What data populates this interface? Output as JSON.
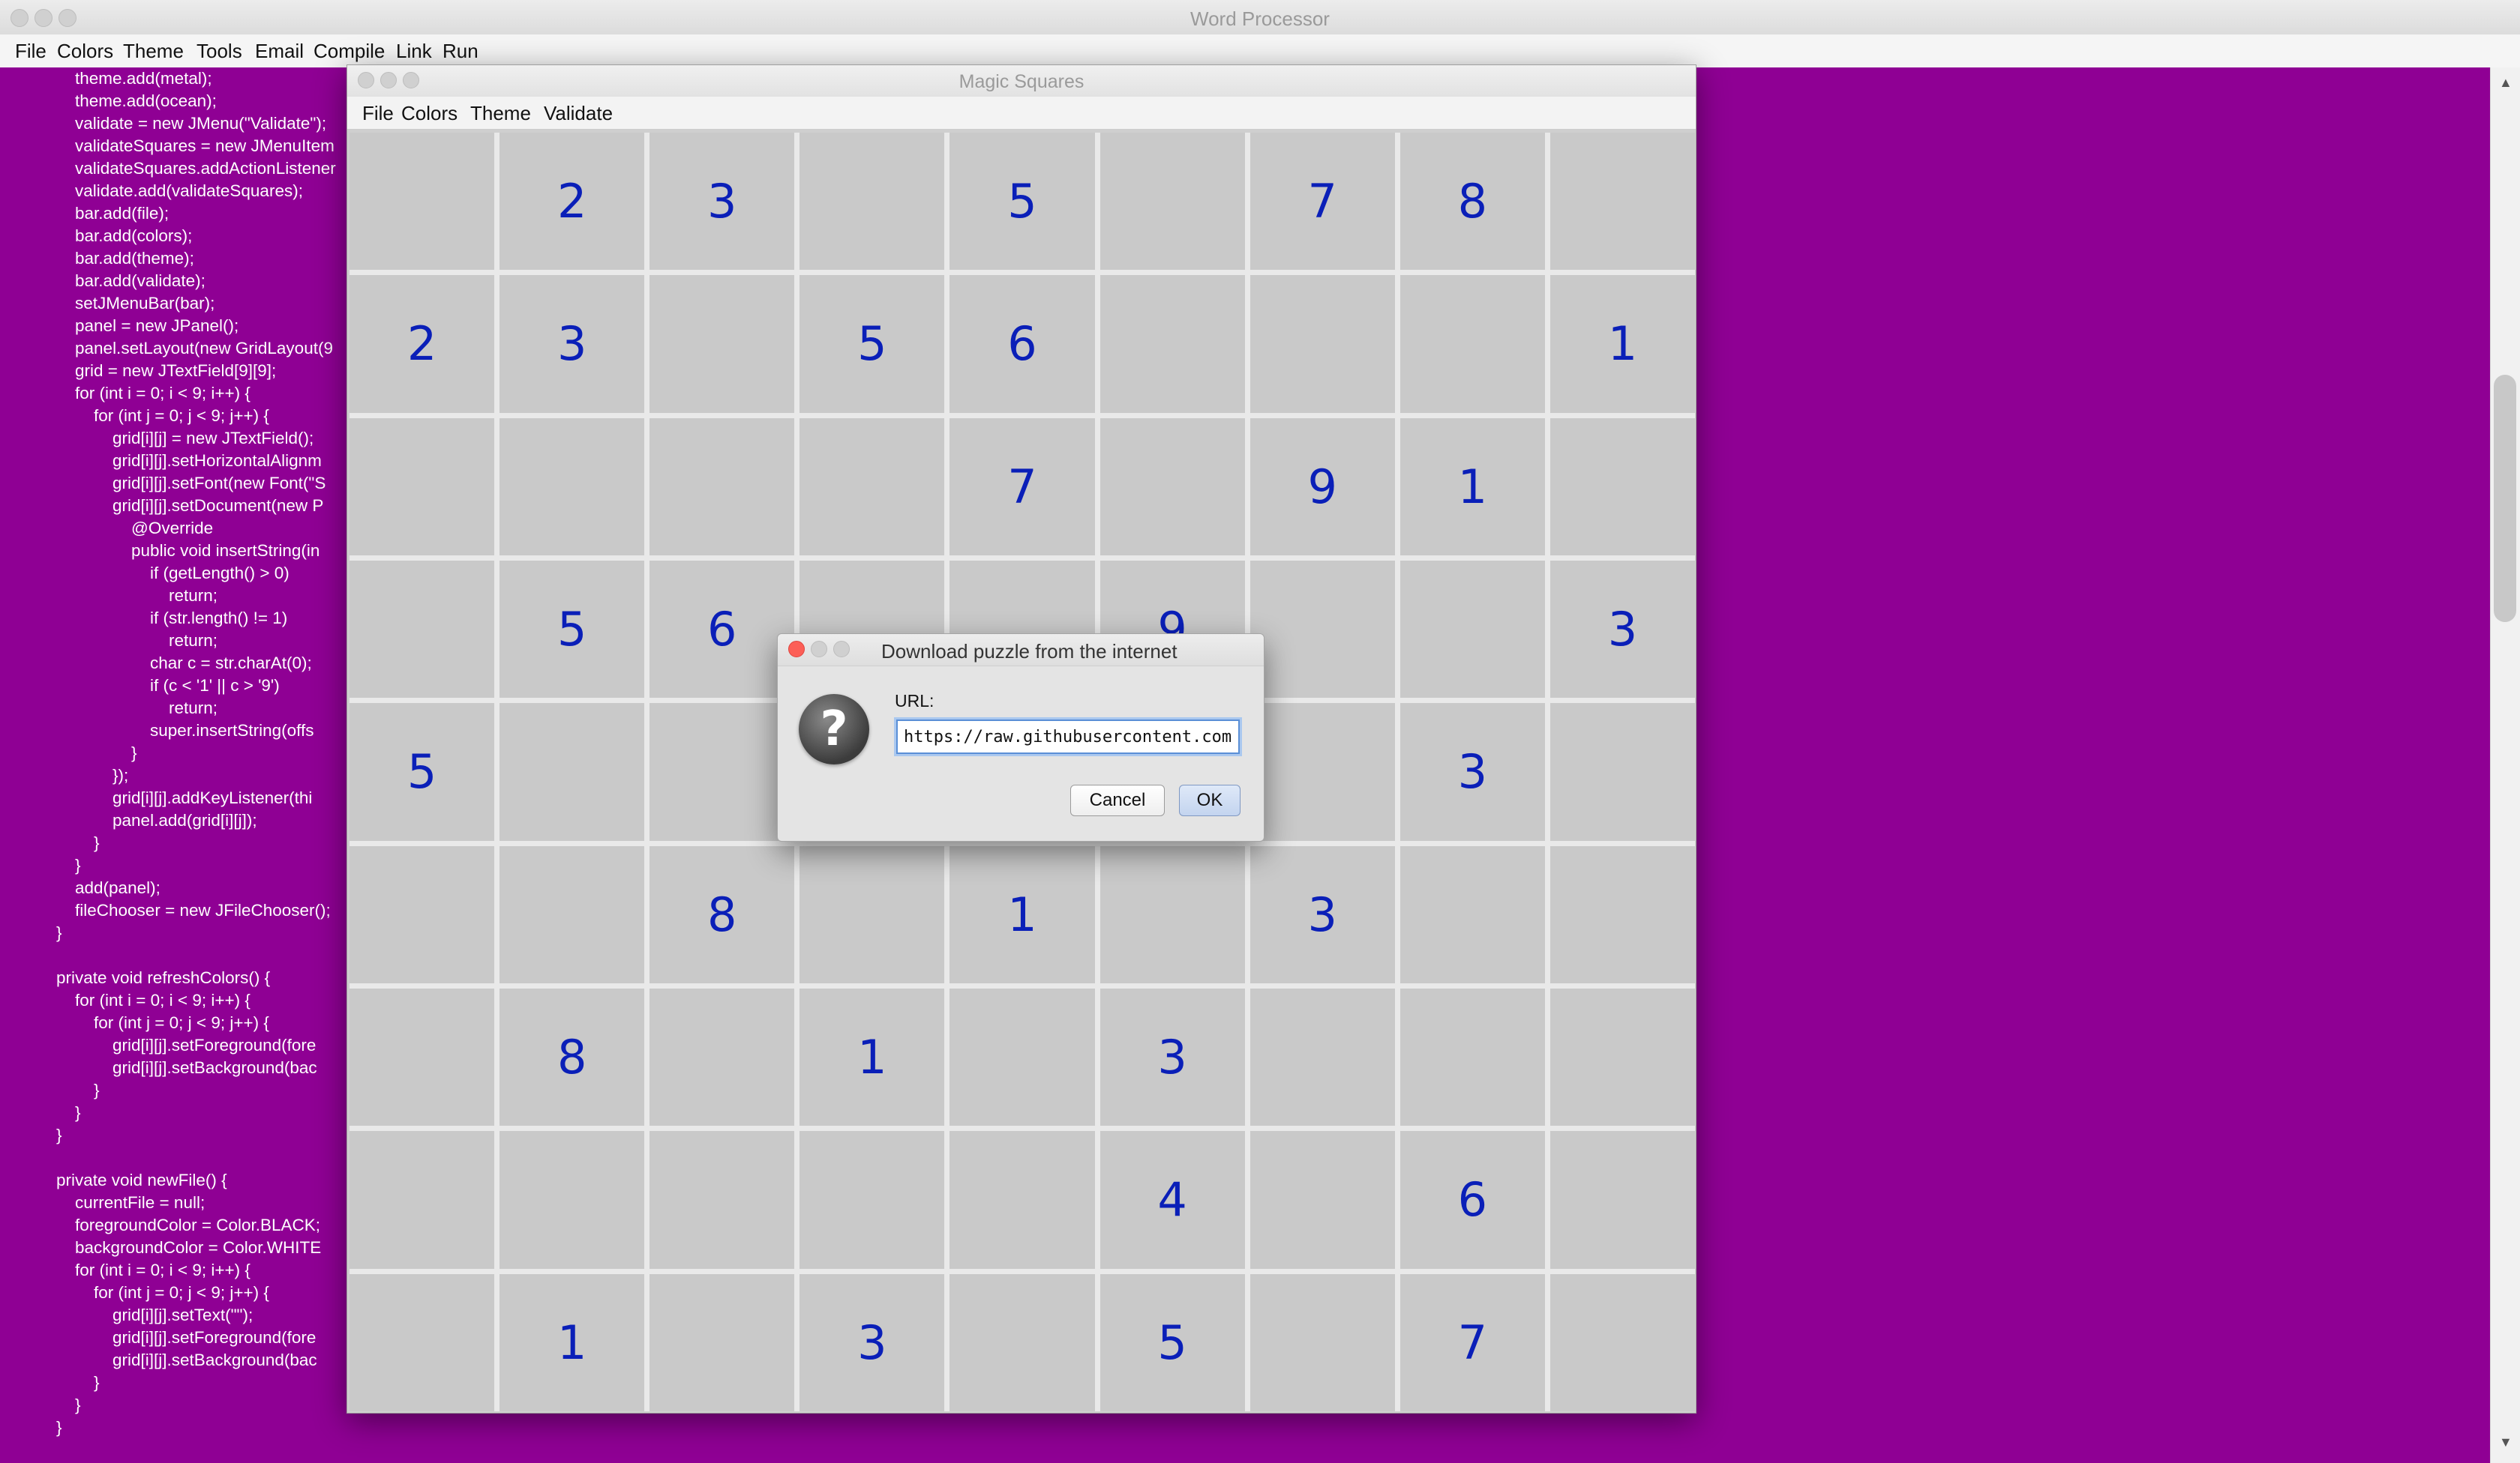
{
  "main_window": {
    "title": "Word Processor",
    "menu": [
      "File",
      "Colors",
      "Theme",
      "Tools",
      "Email",
      "Compile",
      "Link",
      "Run"
    ],
    "editor_background": "#8f0094",
    "code": "        theme.add(metal);\n        theme.add(ocean);\n        validate = new JMenu(\"Validate\");\n        validateSquares = new JMenuItem\n        validateSquares.addActionListener\n        validate.add(validateSquares);\n        bar.add(file);\n        bar.add(colors);\n        bar.add(theme);\n        bar.add(validate);\n        setJMenuBar(bar);\n        panel = new JPanel();\n        panel.setLayout(new GridLayout(9\n        grid = new JTextField[9][9];\n        for (int i = 0; i < 9; i++) {\n            for (int j = 0; j < 9; j++) {\n                grid[i][j] = new JTextField();\n                grid[i][j].setHorizontalAlignm\n                grid[i][j].setFont(new Font(\"S\n                grid[i][j].setDocument(new P\n                    @Override\n                    public void insertString(in\n                        if (getLength() > 0)\n                            return;\n                        if (str.length() != 1)\n                            return;\n                        char c = str.charAt(0);\n                        if (c < '1' || c > '9')\n                            return;\n                        super.insertString(offs\n                    }\n                });\n                grid[i][j].addKeyListener(thi\n                panel.add(grid[i][j]);\n            }\n        }\n        add(panel);\n        fileChooser = new JFileChooser();\n    }\n\n    private void refreshColors() {\n        for (int i = 0; i < 9; i++) {\n            for (int j = 0; j < 9; j++) {\n                grid[i][j].setForeground(fore\n                grid[i][j].setBackground(bac\n            }\n        }\n    }\n\n    private void newFile() {\n        currentFile = null;\n        foregroundColor = Color.BLACK;\n        backgroundColor = Color.WHITE\n        for (int i = 0; i < 9; i++) {\n            for (int j = 0; j < 9; j++) {\n                grid[i][j].setText(\"\");\n                grid[i][j].setForeground(fore\n                grid[i][j].setBackground(bac\n            }\n        }\n    }"
  },
  "magic_squares": {
    "title": "Magic Squares",
    "menu": [
      "File",
      "Colors",
      "Theme",
      "Validate"
    ],
    "grid": [
      [
        "",
        "2",
        "3",
        "",
        "5",
        "",
        "7",
        "8",
        ""
      ],
      [
        "2",
        "3",
        "",
        "5",
        "6",
        "",
        "",
        "",
        "1"
      ],
      [
        "",
        "",
        "",
        "",
        "7",
        "",
        "9",
        "1",
        ""
      ],
      [
        "",
        "5",
        "6",
        "",
        "",
        "9",
        "",
        "",
        "3"
      ],
      [
        "5",
        "",
        "",
        "",
        "",
        "",
        "",
        "3",
        ""
      ],
      [
        "",
        "",
        "8",
        "",
        "1",
        "",
        "3",
        "",
        ""
      ],
      [
        "",
        "8",
        "",
        "1",
        "",
        "3",
        "",
        "",
        ""
      ],
      [
        "",
        "",
        "",
        "",
        "",
        "4",
        "",
        "6",
        ""
      ],
      [
        "",
        "1",
        "",
        "3",
        "",
        "5",
        "",
        "7",
        ""
      ]
    ],
    "digit_color": "#0a1fb8"
  },
  "dialog": {
    "title": "Download puzzle from the internet",
    "icon": "question-icon",
    "url_label": "URL:",
    "url_value": "https://raw.githubusercontent.com/ata",
    "cancel_label": "Cancel",
    "ok_label": "OK"
  }
}
